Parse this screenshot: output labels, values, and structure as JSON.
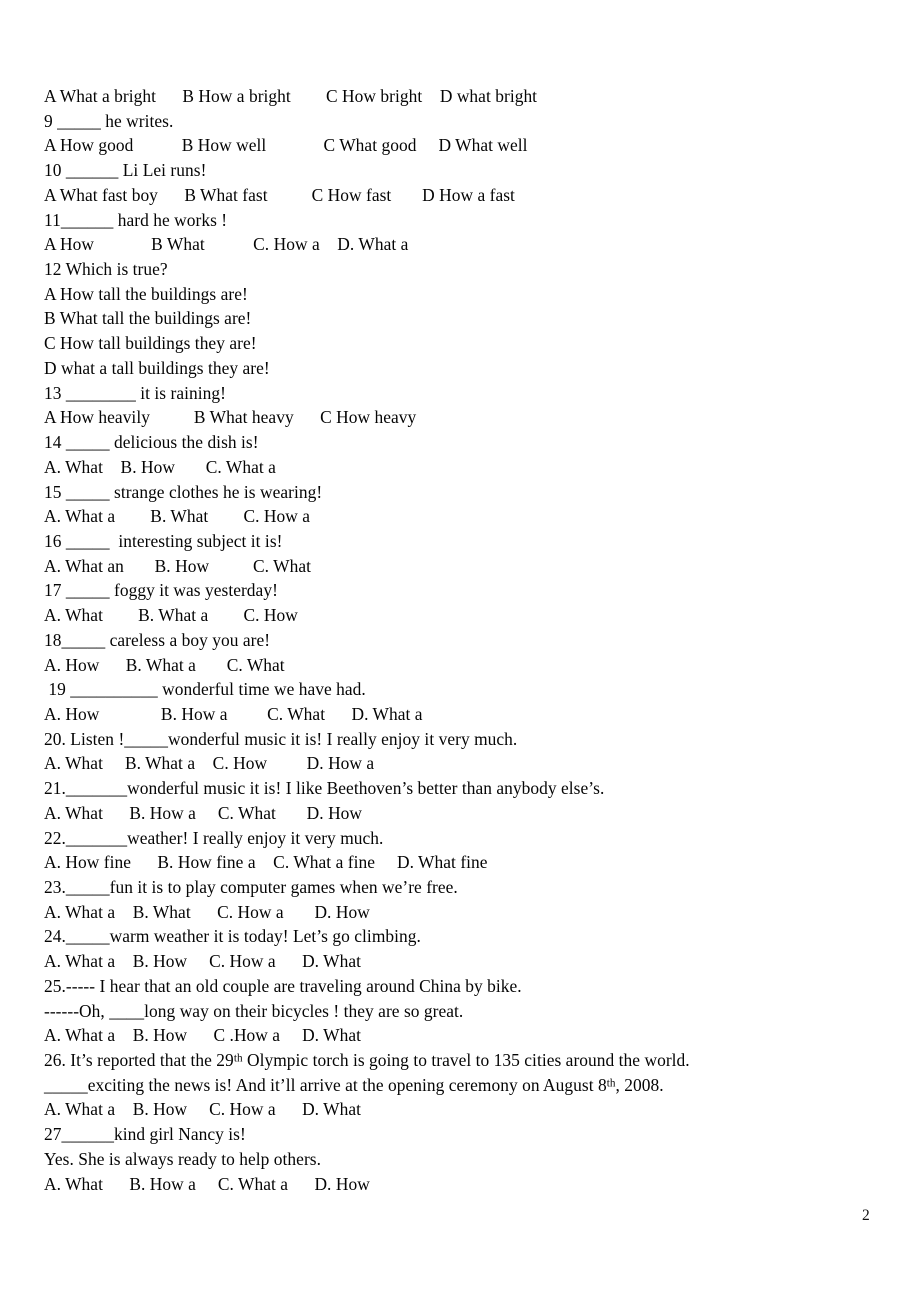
{
  "document": {
    "page_number": "2",
    "lines": [
      {
        "id": "q8-options",
        "text": "A What a bright      B How a bright        C How bright    D what bright"
      },
      {
        "id": "q9-stem",
        "text": "9 _____ he writes."
      },
      {
        "id": "q9-options",
        "text": "A How good           B How well             C What good     D What well"
      },
      {
        "id": "q10-stem",
        "text": "10 ______ Li Lei runs!"
      },
      {
        "id": "q10-options",
        "text": "A What fast boy      B What fast          C How fast       D How a fast"
      },
      {
        "id": "q11-stem",
        "text": "11______ hard he works !"
      },
      {
        "id": "q11-options",
        "text": "A How             B What           C. How a    D. What a"
      },
      {
        "id": "q12-stem",
        "text": "12 Which is true?"
      },
      {
        "id": "q12-option-a",
        "text": "A How tall the buildings are!"
      },
      {
        "id": "q12-option-b",
        "text": "B What tall the buildings are!"
      },
      {
        "id": "q12-option-c",
        "text": "C How tall buildings they are!"
      },
      {
        "id": "q12-option-d",
        "text": "D what a tall buildings they are!"
      },
      {
        "id": "q13-stem",
        "text": "13 ________ it is raining!"
      },
      {
        "id": "q13-options",
        "text": "A How heavily          B What heavy      C How heavy"
      },
      {
        "id": "q14-stem",
        "text": "14 _____ delicious the dish is!"
      },
      {
        "id": "q14-options",
        "text": "A. What    B. How       C. What a"
      },
      {
        "id": "q15-stem",
        "text": "15 _____ strange clothes he is wearing!"
      },
      {
        "id": "q15-options",
        "text": "A. What a        B. What        C. How a"
      },
      {
        "id": "q16-stem",
        "text": "16 _____  interesting subject it is!"
      },
      {
        "id": "q16-options",
        "text": "A. What an       B. How          C. What"
      },
      {
        "id": "q17-stem",
        "text": "17 _____ foggy it was yesterday!"
      },
      {
        "id": "q17-options",
        "text": "A. What        B. What a        C. How"
      },
      {
        "id": "q18-stem",
        "text": "18_____ careless a boy you are!"
      },
      {
        "id": "q18-options",
        "text": "A. How      B. What a       C. What"
      },
      {
        "id": "q19-stem",
        "text": " 19 __________ wonderful time we have had."
      },
      {
        "id": "q19-options",
        "text": "A. How              B. How a         C. What      D. What a"
      },
      {
        "id": "q20-stem",
        "text": "20. Listen !_____wonderful music it is! I really enjoy it very much."
      },
      {
        "id": "q20-options",
        "text": "A. What     B. What a    C. How         D. How a"
      },
      {
        "id": "q21-stem",
        "text": "21._______wonderful music it is! I like Beethoven’s better than anybody else’s."
      },
      {
        "id": "q21-options",
        "text": "A. What      B. How a     C. What       D. How"
      },
      {
        "id": "q22-stem",
        "text": "22._______weather! I really enjoy it very much."
      },
      {
        "id": "q22-options",
        "text": "A. How fine      B. How fine a    C. What a fine     D. What fine"
      },
      {
        "id": "q23-stem",
        "text": "23._____fun it is to play computer games when we’re free."
      },
      {
        "id": "q23-options",
        "text": "A. What a    B. What      C. How a       D. How"
      },
      {
        "id": "q24-stem",
        "text": "24._____warm weather it is today! Let’s go climbing."
      },
      {
        "id": "q24-options",
        "text": "A. What a    B. How     C. How a      D. What"
      },
      {
        "id": "q25-stem-1",
        "text": "25.----- I hear that an old couple are traveling around China by bike."
      },
      {
        "id": "q25-stem-2",
        "text": "------Oh, ____long way on their bicycles ! they are so great."
      },
      {
        "id": "q25-options",
        "text": "A. What a    B. How      C .How a     D. What"
      },
      {
        "id": "q26-stem-1",
        "html": "26. It’s reported that the 29<sup>th</sup> Olympic torch is going to travel to 135 cities around the world."
      },
      {
        "id": "q26-stem-2",
        "html": "_____exciting the news is! And it’ll arrive at the opening ceremony on August 8<sup>th</sup>, 2008."
      },
      {
        "id": "q26-options",
        "text": "A. What a    B. How     C. How a      D. What"
      },
      {
        "id": "q27-stem",
        "text": "27______kind girl Nancy is!"
      },
      {
        "id": "q27-answer",
        "text": "Yes. She is always ready to help others."
      },
      {
        "id": "q27-options",
        "text": "A. What      B. How a     C. What a      D. How"
      }
    ]
  }
}
